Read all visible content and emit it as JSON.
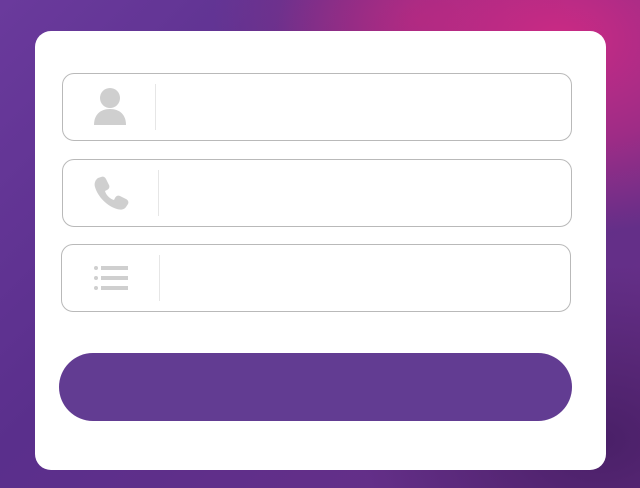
{
  "form": {
    "fields": [
      {
        "icon": "user-icon",
        "value": "",
        "placeholder": ""
      },
      {
        "icon": "phone-icon",
        "value": "",
        "placeholder": ""
      },
      {
        "icon": "list-icon",
        "value": "",
        "placeholder": ""
      }
    ],
    "submit_label": ""
  },
  "colors": {
    "icon": "#cfcfcf",
    "field_border": "#b9b9b9",
    "button": "#623c92",
    "card": "#ffffff"
  }
}
